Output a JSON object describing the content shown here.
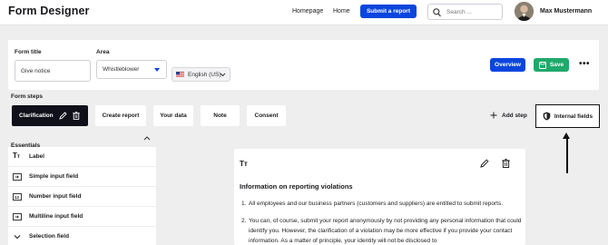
{
  "header": {
    "title": "Form Designer",
    "nav": [
      "Homepage",
      "Home"
    ],
    "submit_report": "Submit a report",
    "search_placeholder": "Search ...",
    "user_name": "Max Mustermann"
  },
  "form": {
    "title_label": "Form title",
    "title_value": "Give notice",
    "area_label": "Area",
    "area_value": "Whistleblower",
    "language": "English (US)",
    "overview_label": "Overview",
    "save_label": "Save",
    "more_label": "•••"
  },
  "steps": {
    "label": "Form steps",
    "items": [
      "Clarification",
      "Create report",
      "Your data",
      "Note",
      "Consent"
    ],
    "add_step": "Add step",
    "internal_fields": "Internal fields"
  },
  "essentials": {
    "label": "Essentials",
    "items": [
      "Label",
      "Simple input field",
      "Number input field",
      "Multiline input field",
      "Selection field"
    ]
  },
  "content": {
    "tt": "Tт",
    "heading": "Information on reporting violations",
    "paragraphs": [
      "All employees and our business partners (customers and suppliers) are entitled to submit reports.",
      "You can, of course, submit your report anonymously by not providing any personal information that could identify you. However, the clarification of a violation may be more effective if you provide your contact information. As a matter of principle, your identity will not be disclosed to"
    ],
    "numbers": [
      "1.",
      "2."
    ]
  },
  "colors": {
    "primary": "#0a46dd",
    "save": "#1fa96b",
    "active_step": "#10101a"
  }
}
